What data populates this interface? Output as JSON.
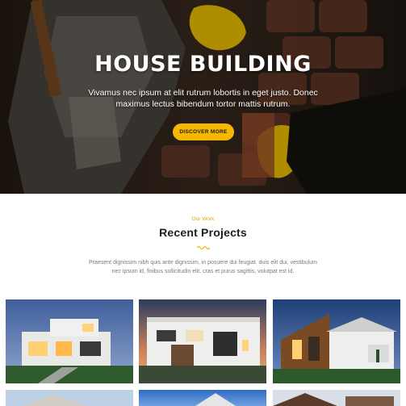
{
  "hero": {
    "title": "HOUSE BUILDING",
    "subtitle": "Vivamus nec ipsum at elit rutrum lobortis in eget justo. Donec maximus lectus bibendum tortor mattis rutrum.",
    "cta_label": "DISCOVER MORE",
    "accent_color": "#f5b700"
  },
  "projects_section": {
    "eyebrow": "Our Work",
    "title": "Recent Projects",
    "description": "Praesent dignissim nibh quis ante dignissim, in posuere dui feugiat. duis elit dui, vestibulum nec ipsum id, finibus sollicitudin elit. cras et purus sagittis, volutpat est id.",
    "projects": [
      {
        "subject": "modern white house at dusk"
      },
      {
        "subject": "modern white house with sunset sky"
      },
      {
        "subject": "modern wooden cladding house"
      },
      {
        "subject": "house exterior"
      },
      {
        "subject": "house exterior"
      },
      {
        "subject": "house exterior"
      }
    ]
  }
}
